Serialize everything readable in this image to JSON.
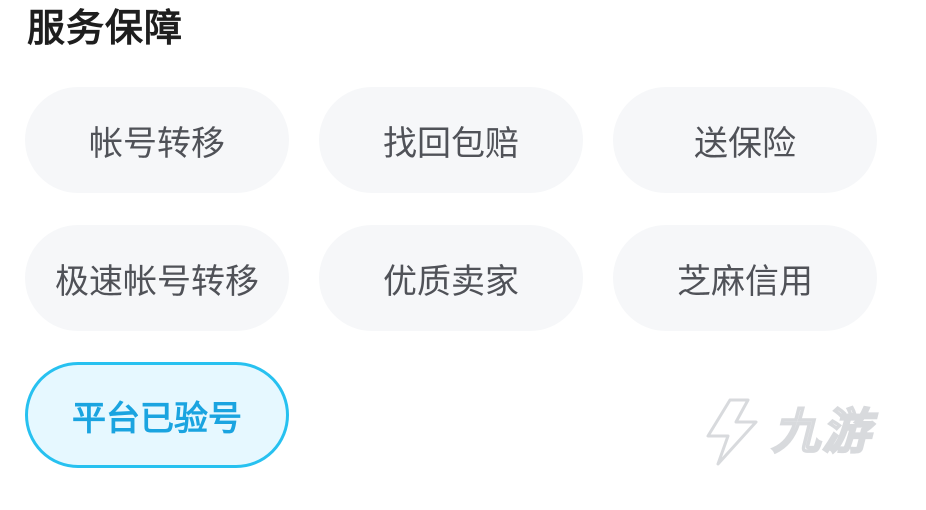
{
  "section": {
    "title": "服务保障"
  },
  "tags": [
    {
      "label": "帐号转移"
    },
    {
      "label": "找回包赔"
    },
    {
      "label": "送保险"
    },
    {
      "label": "极速帐号转移"
    },
    {
      "label": "优质卖家"
    },
    {
      "label": "芝麻信用"
    }
  ],
  "active_tag": {
    "label": "平台已验号"
  },
  "watermark": {
    "text": "九游",
    "icon": "jiuyou-logo-icon"
  },
  "colors": {
    "tag_bg": "#f6f7f9",
    "tag_text": "#505258",
    "active_bg": "#e6f8ff",
    "active_border": "#27c1f0",
    "active_text": "#1aa4e0",
    "watermark": "#d4d6da"
  }
}
